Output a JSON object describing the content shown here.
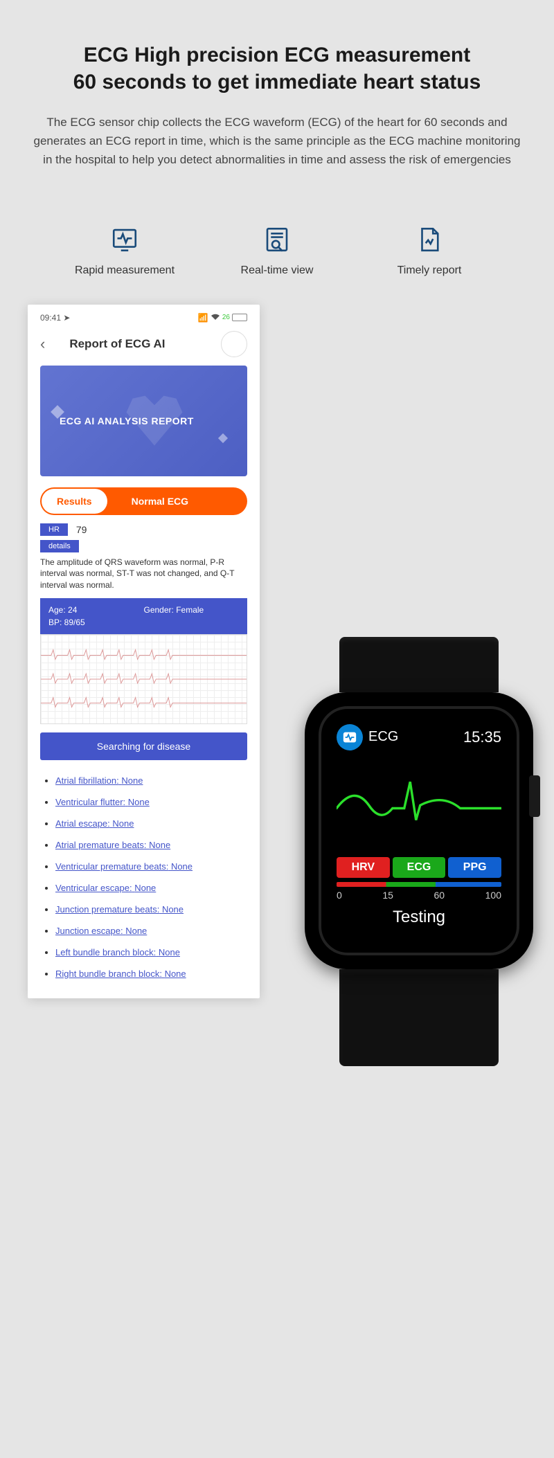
{
  "hero": {
    "title_line1": "ECG High precision ECG measurement",
    "title_line2": "60 seconds to get immediate heart status",
    "desc": "The ECG sensor chip collects the ECG waveform (ECG) of the heart for 60 seconds and generates an ECG report in time, which is the same principle as the ECG machine monitoring in the hospital to help you detect abnormalities in time and assess the risk of emergencies"
  },
  "features": [
    {
      "label": "Rapid measurement"
    },
    {
      "label": "Real-time view"
    },
    {
      "label": "Timely report"
    }
  ],
  "phone": {
    "statusbar": {
      "time": "09:41",
      "battery": "26"
    },
    "navbar": {
      "title": "Report of ECG AI"
    },
    "banner": {
      "title": "ECG AI ANALYSIS REPORT"
    },
    "pill": {
      "results": "Results",
      "normal": "Normal ECG"
    },
    "hr": {
      "tag": "HR",
      "value": "79"
    },
    "details": {
      "tag": "details",
      "text": "The amplitude of QRS waveform was normal, P-R interval was normal, ST-T was not changed, and Q-T interval was normal."
    },
    "info": {
      "age": "Age: 24",
      "gender": "Gender: Female",
      "bp": "BP: 89/65"
    },
    "searching": "Searching for disease",
    "diseases": [
      {
        "label": "Atrial fibrillation:",
        "value": "None"
      },
      {
        "label": "Ventricular flutter:",
        "value": "None"
      },
      {
        "label": "Atrial escape:",
        "value": "None"
      },
      {
        "label": "Atrial premature beats:",
        "value": "None"
      },
      {
        "label": "Ventricular premature beats:",
        "value": "None"
      },
      {
        "label": "Ventricular escape:",
        "value": "None"
      },
      {
        "label": "Junction premature beats:",
        "value": "None"
      },
      {
        "label": "Junction escape:",
        "value": "None"
      },
      {
        "label": "Left bundle branch block:",
        "value": "None"
      },
      {
        "label": "Right bundle branch block:",
        "value": "None"
      }
    ]
  },
  "watch": {
    "title": "ECG",
    "time": "15:35",
    "modes": {
      "hrv": "HRV",
      "ecg": "ECG",
      "ppg": "PPG"
    },
    "ticks": [
      "0",
      "15",
      "60",
      "100"
    ],
    "testing": "Testing"
  }
}
